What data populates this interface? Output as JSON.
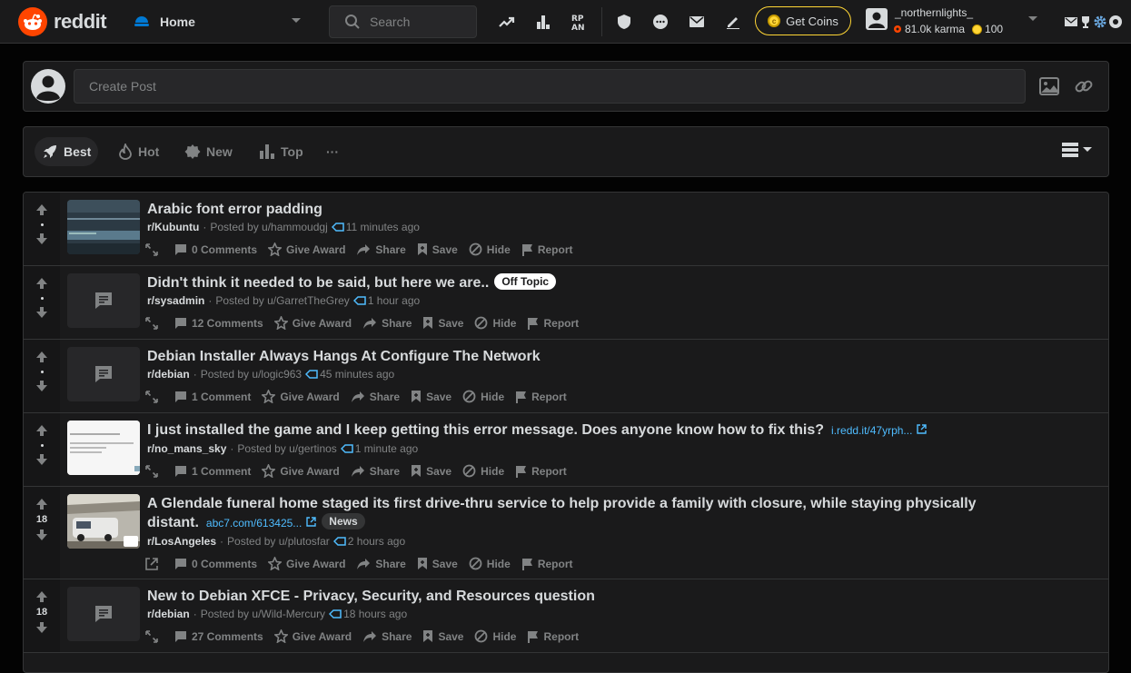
{
  "header": {
    "logo_text": "reddit",
    "home_label": "Home",
    "search_placeholder": "Search",
    "get_coins_label": "Get Coins",
    "username": "_northernlights_",
    "karma": "81.0k karma",
    "coins": "100"
  },
  "create_post": {
    "placeholder": "Create Post"
  },
  "sort": {
    "best": "Best",
    "hot": "Hot",
    "new": "New",
    "top": "Top",
    "more": "···"
  },
  "posts": [
    {
      "title": "Arabic font error padding",
      "subreddit": "r/Kubuntu",
      "posted_by": "Posted by u/hammoudgj",
      "time": "11 minutes ago",
      "score": "",
      "comments": "0 Comments",
      "flair": "",
      "link": ""
    },
    {
      "title": "Didn't think it needed to be said, but here we are..",
      "subreddit": "r/sysadmin",
      "posted_by": "Posted by u/GarretTheGrey",
      "time": "1 hour ago",
      "score": "",
      "comments": "12 Comments",
      "flair": "Off Topic",
      "link": ""
    },
    {
      "title": "Debian Installer Always Hangs At Configure The Network",
      "subreddit": "r/debian",
      "posted_by": "Posted by u/logic963",
      "time": "45 minutes ago",
      "score": "",
      "comments": "1 Comment",
      "flair": "",
      "link": ""
    },
    {
      "title": "I just installed the game and I keep getting this error message. Does anyone know how to fix this?",
      "subreddit": "r/no_mans_sky",
      "posted_by": "Posted by u/gertinos",
      "time": "1 minute ago",
      "score": "",
      "comments": "1 Comment",
      "flair": "",
      "link": "i.redd.it/47yrph..."
    },
    {
      "title": "A Glendale funeral home staged its first drive-thru service to help provide a family with closure, while staying physically distant.",
      "subreddit": "r/LosAngeles",
      "posted_by": "Posted by u/plutosfar",
      "time": "2 hours ago",
      "score": "18",
      "comments": "0 Comments",
      "flair": "News",
      "link": "abc7.com/613425..."
    },
    {
      "title": "New to Debian XFCE - Privacy, Security, and Resources question",
      "subreddit": "r/debian",
      "posted_by": "Posted by u/Wild-Mercury",
      "time": "18 hours ago",
      "score": "18",
      "comments": "27 Comments",
      "flair": "",
      "link": ""
    }
  ],
  "actions": {
    "give_award": "Give Award",
    "share": "Share",
    "save": "Save",
    "hide": "Hide",
    "report": "Report"
  },
  "colors": {
    "brand": "#ff4500",
    "background": "#030303",
    "card": "#1a1a1b",
    "text": "#d7dadc",
    "muted": "#818384",
    "link": "#4fbcff",
    "coin": "#ffd635"
  }
}
